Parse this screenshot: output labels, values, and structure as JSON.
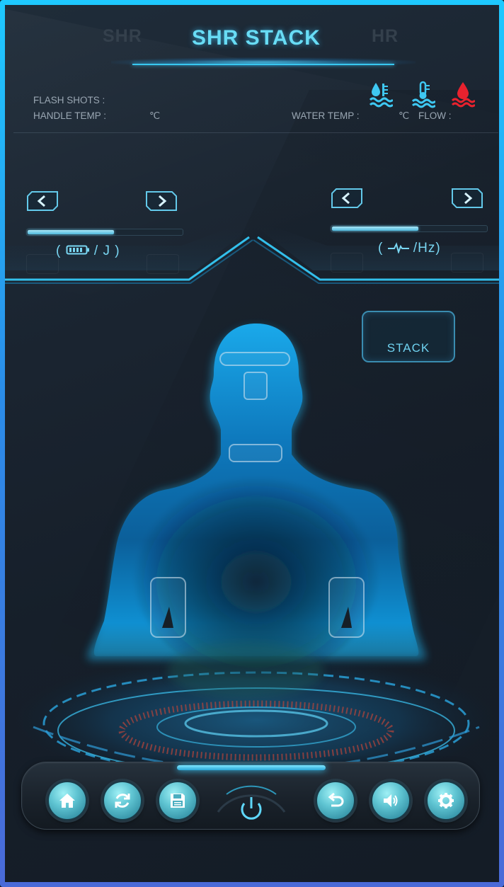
{
  "header": {
    "tabs": [
      {
        "label": "SHR",
        "active": false
      },
      {
        "label": "SHR STACK",
        "active": true
      },
      {
        "label": "HR",
        "active": false
      }
    ]
  },
  "info": {
    "flash_shots_label": "FLASH SHOTS :",
    "handle_temp_label": "HANDLE TEMP :",
    "handle_temp_unit": "℃",
    "water_temp_label": "WATER TEMP :",
    "water_temp_unit": "℃",
    "flow_label": "FLOW :"
  },
  "status_icons": [
    "water-level-icon",
    "water-temp-icon",
    "flow-icon"
  ],
  "energy_control": {
    "unit_label": "/ J )",
    "level": 0.56,
    "icons": [
      "chevron-left-icon",
      "chevron-right-icon",
      "battery-icon"
    ]
  },
  "frequency_control": {
    "unit_label": "/Hz)",
    "level": 0.56,
    "icons": [
      "chevron-left-icon",
      "chevron-right-icon",
      "pulse-icon"
    ]
  },
  "stack_button": {
    "label": "STACK"
  },
  "treatment_zones": [
    "forehead",
    "chin",
    "neck",
    "left-arm",
    "right-arm"
  ],
  "dock": {
    "buttons": [
      "home-icon",
      "refresh-icon",
      "save-icon",
      "power-icon",
      "back-icon",
      "volume-icon",
      "settings-icon"
    ]
  },
  "colors": {
    "accent": "#3cc8f5",
    "background": "#1a2430",
    "alert_red": "#e8222e",
    "tab_inactive": "#34404c"
  }
}
